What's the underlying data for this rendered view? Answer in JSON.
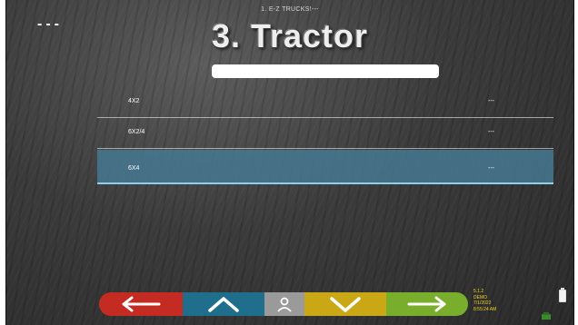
{
  "header": {
    "dashes": "---",
    "breadcrumb": "1. E-Z TRUCKS!---",
    "title": "3. Tractor"
  },
  "list": [
    {
      "label": "4X2",
      "value": "---"
    },
    {
      "label": "6X2/4",
      "value": "---"
    },
    {
      "label": "6X4",
      "value": "---",
      "selected": true
    }
  ],
  "nav": {
    "back": "arrow-left-icon",
    "up": "chevron-up-icon",
    "user": "user-icon",
    "down": "chevron-down-icon",
    "next": "arrow-right-icon"
  },
  "status": {
    "version": "5.1.2",
    "mode": "DEMO",
    "date": "7/1/2022",
    "time": "8:55:24 AM"
  },
  "colors": {
    "back": "#c42b22",
    "up": "#1f6e8c",
    "user": "#9a9a9a",
    "down": "#c9a715",
    "next": "#79ad2c",
    "selected_row": "#46788f",
    "status_text": "#f2d21c"
  }
}
